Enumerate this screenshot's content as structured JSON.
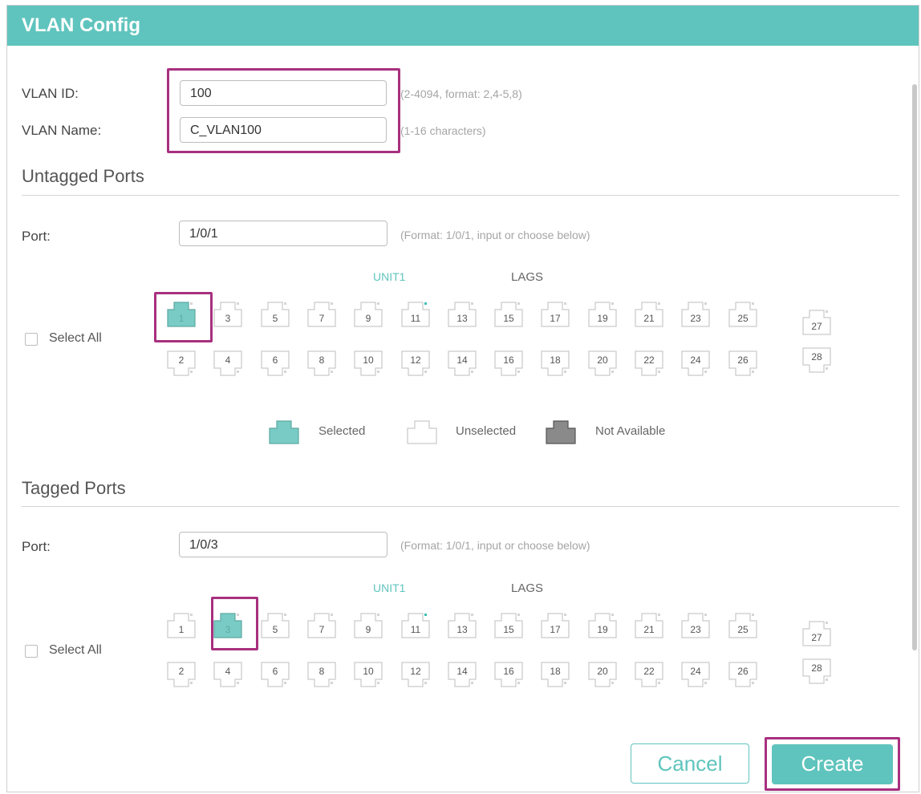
{
  "window": {
    "title": "VLAN Config"
  },
  "basic": {
    "vlan_id_label": "VLAN ID:",
    "vlan_id_value": "100",
    "vlan_id_hint": "(2-4094, format: 2,4-5,8)",
    "vlan_name_label": "VLAN Name:",
    "vlan_name_value": "C_VLAN100",
    "vlan_name_hint": "(1-16 characters)"
  },
  "untagged": {
    "title": "Untagged Ports",
    "port_label": "Port:",
    "port_value": "1/0/1",
    "port_hint": "(Format: 1/0/1, input or choose below)",
    "unit_label": "UNIT1",
    "lags_label": "LAGS",
    "select_all_label": "Select All",
    "selected_ports": [
      1
    ]
  },
  "legend": {
    "selected": "Selected",
    "unselected": "Unselected",
    "not_available": "Not Available"
  },
  "tagged": {
    "title": "Tagged Ports",
    "port_label": "Port:",
    "port_value": "1/0/3",
    "port_hint": "(Format: 1/0/1, input or choose below)",
    "unit_label": "UNIT1",
    "lags_label": "LAGS",
    "select_all_label": "Select All",
    "selected_ports": [
      3
    ]
  },
  "ports": {
    "top_row": [
      "1",
      "3",
      "5",
      "7",
      "9",
      "11",
      "13",
      "15",
      "17",
      "19",
      "21",
      "23",
      "25"
    ],
    "bottom_row": [
      "2",
      "4",
      "6",
      "8",
      "10",
      "12",
      "14",
      "16",
      "18",
      "20",
      "22",
      "24",
      "26"
    ],
    "lag_top": "27",
    "lag_bottom": "28"
  },
  "buttons": {
    "cancel": "Cancel",
    "create": "Create"
  },
  "colors": {
    "accent": "#5fc4bd",
    "highlight": "#a8307f",
    "not_available": "#8a8a8a"
  }
}
